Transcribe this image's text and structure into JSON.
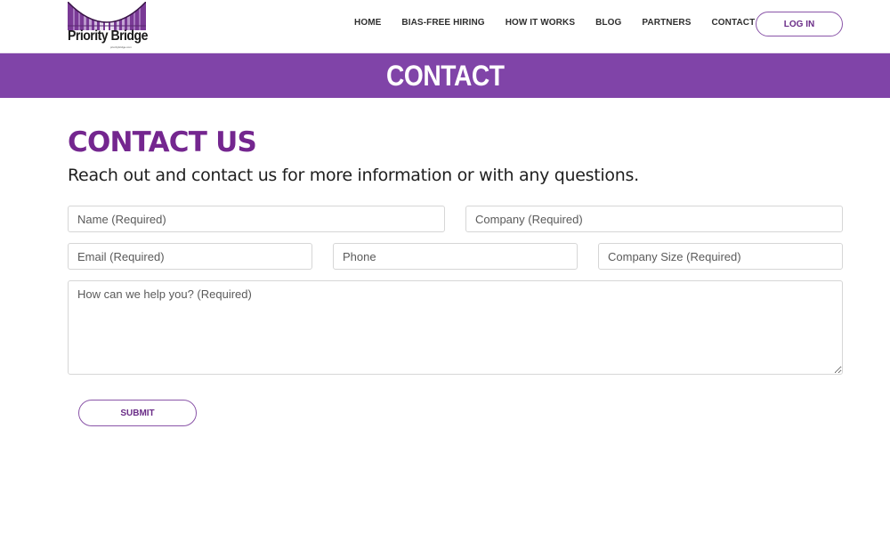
{
  "header": {
    "logo": {
      "name": "Priority Bridge",
      "tagline": "prioritybridge.com"
    },
    "nav": [
      {
        "label": "HOME"
      },
      {
        "label": "BIAS-FREE HIRING"
      },
      {
        "label": "HOW IT WORKS"
      },
      {
        "label": "BLOG"
      },
      {
        "label": "PARTNERS"
      },
      {
        "label": "CONTACT"
      }
    ],
    "login_label": "LOG IN"
  },
  "banner": {
    "title": "CONTACT"
  },
  "main": {
    "heading": "CONTACT US",
    "subheading": "Reach out and contact us for more information or with any questions.",
    "form": {
      "name": {
        "placeholder": "Name (Required)",
        "value": ""
      },
      "company": {
        "placeholder": "Company (Required)",
        "value": ""
      },
      "email": {
        "placeholder": "Email (Required)",
        "value": ""
      },
      "phone": {
        "placeholder": "Phone",
        "value": ""
      },
      "company_size": {
        "placeholder": "Company Size (Required)",
        "value": ""
      },
      "message": {
        "placeholder": "How can we help you? (Required)",
        "value": ""
      },
      "submit_label": "SUBMIT"
    }
  },
  "colors": {
    "brand_purple": "#8044a8",
    "heading_purple": "#74268f",
    "button_border": "#8a55a8",
    "button_text": "#6a2c87"
  }
}
